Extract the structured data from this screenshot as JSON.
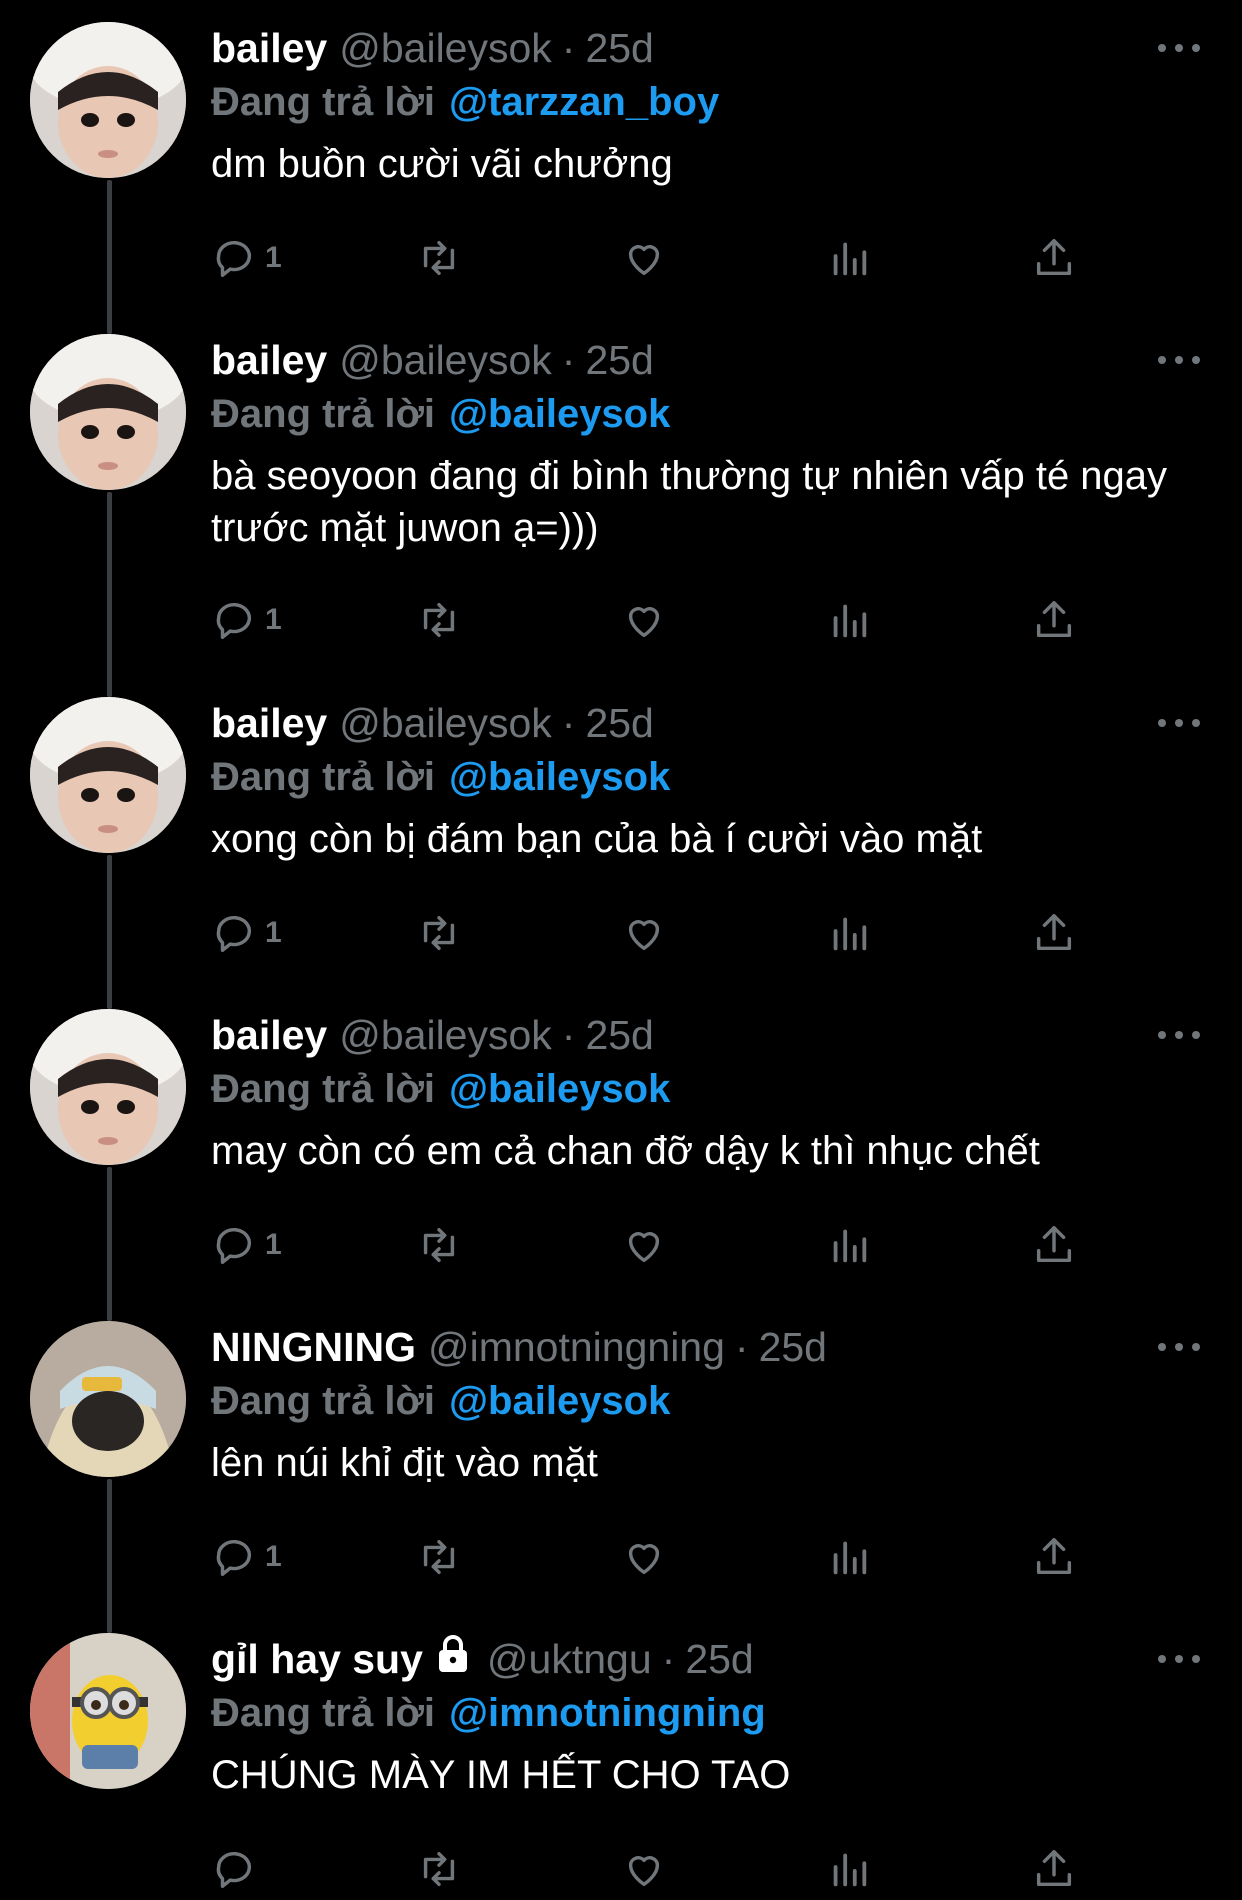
{
  "colors": {
    "background": "#000000",
    "name": "#ffffff",
    "muted": "#71767b",
    "accent": "#1d9bf0"
  },
  "icons": [
    "reply-icon",
    "retweet-icon",
    "like-icon",
    "views-icon",
    "share-icon",
    "more-icon",
    "lock-icon"
  ],
  "tweets": [
    {
      "name": "bailey",
      "handle": "@baileysok",
      "sep": "·",
      "time": "25d",
      "reply_label": "Đang trả lời",
      "reply_to": "@tarzzan_boy",
      "text": "dm buồn cười vãi chưởng",
      "reply_count": "1"
    },
    {
      "name": "bailey",
      "handle": "@baileysok",
      "sep": "·",
      "time": "25d",
      "reply_label": "Đang trả lời",
      "reply_to": "@baileysok",
      "text": "bà seoyoon đang đi bình thường tự nhiên vấp té ngay trước mặt juwon ạ=)))",
      "reply_count": "1"
    },
    {
      "name": "bailey",
      "handle": "@baileysok",
      "sep": "·",
      "time": "25d",
      "reply_label": "Đang trả lời",
      "reply_to": "@baileysok",
      "text": "xong còn bị đám bạn của bà í cười vào mặt",
      "reply_count": "1"
    },
    {
      "name": "bailey",
      "handle": "@baileysok",
      "sep": "·",
      "time": "25d",
      "reply_label": "Đang trả lời",
      "reply_to": "@baileysok",
      "text": "may còn có em cả chan đỡ dậy k thì nhục chết",
      "reply_count": "1"
    },
    {
      "name": "NINGNING",
      "handle": "@imnotningning",
      "sep": "·",
      "time": "25d",
      "reply_label": "Đang trả lời",
      "reply_to": "@baileysok",
      "text": "lên núi khỉ địt vào mặt",
      "reply_count": "1"
    },
    {
      "name": "gỉl hay suy",
      "handle": "@uktngu",
      "sep": "·",
      "time": "25d",
      "reply_label": "Đang trả lời",
      "reply_to": "@imnotningning",
      "text": "CHÚNG MÀY IM HẾT CHO TAO",
      "reply_count": ""
    }
  ]
}
